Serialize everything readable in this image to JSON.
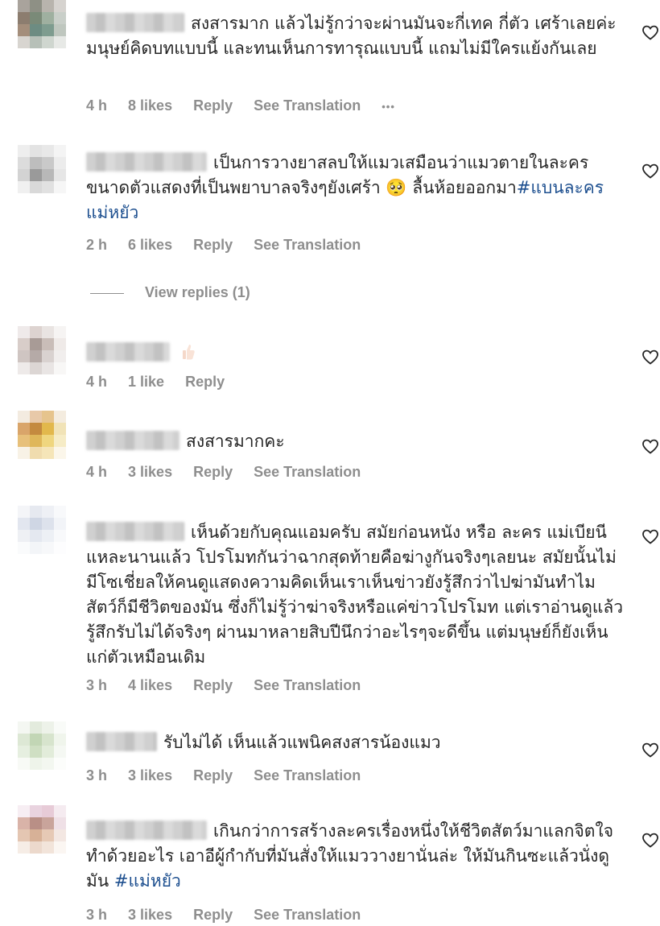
{
  "comments": [
    {
      "text": "สงสารมาก แล้วไม่รู้กว่าจะผ่านมันจะกี่เทค กี่ตัว เศร้าเลยค่ะ มนุษย์คิดบทแบบนี้ และทนเห็นการทารุณแบบนี้ แถมไม่มีใครแย้งกันเลย",
      "time": "4 h",
      "likes": "8 likes",
      "reply": "Reply",
      "translation": "See Translation",
      "more": "•••",
      "avatar_colors": [
        "#a9a39c",
        "#8e9085",
        "#b8b4ad",
        "#d6d3cf",
        "#8c7d6f",
        "#7a8a78",
        "#9fb0a0",
        "#c9cfc9",
        "#a48e7b",
        "#6d8c82",
        "#7e9c8f",
        "#bfc7bf",
        "#d8d5d0",
        "#b7c0b8",
        "#cfd6cf",
        "#e7e9e6"
      ]
    },
    {
      "text": "เป็นการวางยาสลบให้แมวเสมือนว่าแมวตายในละครขนาดตัวแสดงที่เป็นพยาบาลจริงๆยังเศร้า 🥺 ลื้นห้อยออกมา",
      "hashtag": "#แบนละครแม่หยัว",
      "time": "2 h",
      "likes": "6 likes",
      "reply": "Reply",
      "translation": "See Translation",
      "avatar_colors": [
        "#eeeeee",
        "#e3e3e3",
        "#e8e8e8",
        "#f4f4f4",
        "#dcdcdc",
        "#bdbdbd",
        "#c9c9c9",
        "#ececec",
        "#d3d3d3",
        "#9a9a9a",
        "#b8b8b8",
        "#e6e6e6",
        "#f0f0f0",
        "#d9d9d9",
        "#e1e1e1",
        "#f6f6f6"
      ]
    },
    {
      "text": "",
      "time": "4 h",
      "likes": "1 like",
      "reply": "Reply",
      "avatar_colors": [
        "#efeaea",
        "#ddd3d0",
        "#e9e4e2",
        "#f6f4f3",
        "#d8cdc9",
        "#a89b96",
        "#c9bdb8",
        "#efeae8",
        "#cfc5c2",
        "#b5aaa7",
        "#d9d2d0",
        "#f1eeed",
        "#eeeae9",
        "#dcd6d4",
        "#e9e5e4",
        "#f8f7f6"
      ]
    },
    {
      "text": "สงสารมากคะ",
      "time": "4 h",
      "likes": "3 likes",
      "reply": "Reply",
      "translation": "See Translation",
      "avatar_colors": [
        "#f3ebe0",
        "#e8c9a9",
        "#e6c48d",
        "#f4ecdf",
        "#d9a56a",
        "#c48a3f",
        "#e2b84c",
        "#f1e3b7",
        "#e7c07a",
        "#dfb75a",
        "#efd67f",
        "#f6ecc6",
        "#f8f2e6",
        "#f0dcae",
        "#f5e5b8",
        "#fbf6ea"
      ]
    },
    {
      "text": "เห็นด้วยกับคุณแอมครับ สมัยก่อนหนัง หรือ ละคร แม่เบียนีแหละนานแล้ว โปรโมทกันว่าฉากสุดท้ายคือฆ่างูกันจริงๆเลยนะ สมัยนั้นไม่มีโซเชี่ยลให้คนดูแสดงความคิดเห็นเราเห็นข่าวยังรู้สึกว่าไปฆ่ามันทำไมสัตว์ก็มีชีวิตของมัน ซึ่งก็ไม่รู้ว่าฆ่าจริงหรือแค่ข่าวโปรโมท แต่เราอ่านดูแล้วรู้สึกรับไม่ได้จริงๆ ผ่านมาหลายสิบปีนึกว่าอะไรๆจะดีขึ้น แต่มนุษย์ก็ยังเห็นแก่ตัวเหมือนเดิม",
      "time": "3 h",
      "likes": "4 likes",
      "reply": "Reply",
      "translation": "See Translation",
      "avatar_colors": [
        "#f4f5f8",
        "#e6e9f0",
        "#eef0f5",
        "#f8f9fb",
        "#e2e6ef",
        "#cfd6e4",
        "#dde2ec",
        "#f2f4f8",
        "#eef0f4",
        "#e4e8f0",
        "#edf0f5",
        "#f8f9fb",
        "#fafbfc",
        "#f3f5f8",
        "#f7f8fa",
        "#fdfdfe"
      ]
    },
    {
      "text": "รับไม่ได้ เห็นแล้วแพนิคสงสารน้องแมว",
      "time": "3 h",
      "likes": "3 likes",
      "reply": "Reply",
      "translation": "See Translation",
      "avatar_colors": [
        "#f4f7f2",
        "#e3ebdd",
        "#edf2e9",
        "#f9fbf8",
        "#dde8d5",
        "#c2d6b5",
        "#d7e4cd",
        "#f0f5ec",
        "#e6efe0",
        "#cfdfc3",
        "#e2ecda",
        "#f5f8f3",
        "#f8faf6",
        "#eef4ea",
        "#f3f7f0",
        "#fcfdfb"
      ]
    },
    {
      "text": "เกินกว่าการสร้างละครเรื่องหนึ่งให้ชีวิตสัตว์มาแลกจิตใจทำด้วยอะไร เอาอีผู้กำกับที่มันสั่งให้แมววางยานั่นล่ะ ให้มันกินซะแล้วนั่งดูมัน",
      "hashtag": "#แม่หยัว",
      "time": "3 h",
      "likes": "3 likes",
      "reply": "Reply",
      "translation": "See Translation",
      "avatar_colors": [
        "#f7eef3",
        "#e9d3df",
        "#e7cbd7",
        "#f5ebf0",
        "#d9b3a8",
        "#b98f86",
        "#c9a49b",
        "#efe0e6",
        "#e4c6b2",
        "#d7b197",
        "#e6c9b5",
        "#f3e7e2",
        "#f6ede6",
        "#ecd9cc",
        "#f2e4da",
        "#fbf6f2"
      ]
    }
  ],
  "view_replies": "View replies (1)"
}
